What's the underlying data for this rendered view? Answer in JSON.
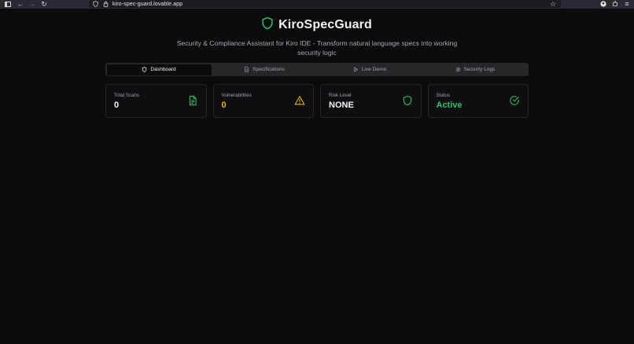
{
  "browser": {
    "url": "kiro-spec-guard.lovable.app"
  },
  "header": {
    "title": "KiroSpecGuard",
    "subtitle": "Security & Compliance Assistant for Kiro IDE - Transform natural language specs into working security logic"
  },
  "tabs": [
    {
      "label": "Dashboard",
      "icon": "shield-icon",
      "active": true
    },
    {
      "label": "Specifications",
      "icon": "document-icon",
      "active": false
    },
    {
      "label": "Live Demo",
      "icon": "play-icon",
      "active": false
    },
    {
      "label": "Security Logs",
      "icon": "gear-icon",
      "active": false
    }
  ],
  "stats": [
    {
      "label": "Total Scans",
      "value": "0",
      "color": "#f4f4f5",
      "icon": "document-icon",
      "icon_color": "#22c55e"
    },
    {
      "label": "Vulnerabilities",
      "value": "0",
      "color": "#eab308",
      "icon": "warning-icon",
      "icon_color": "#eab308"
    },
    {
      "label": "Risk Level",
      "value": "NONE",
      "color": "#f4f4f5",
      "icon": "shield-icon",
      "icon_color": "#22c55e"
    },
    {
      "label": "Status",
      "value": "Active",
      "color": "#22c55e",
      "icon": "check-circle-icon",
      "icon_color": "#22c55e"
    }
  ],
  "colors": {
    "accent": "#22c55e",
    "warning": "#eab308",
    "background": "#0b0b0d"
  }
}
